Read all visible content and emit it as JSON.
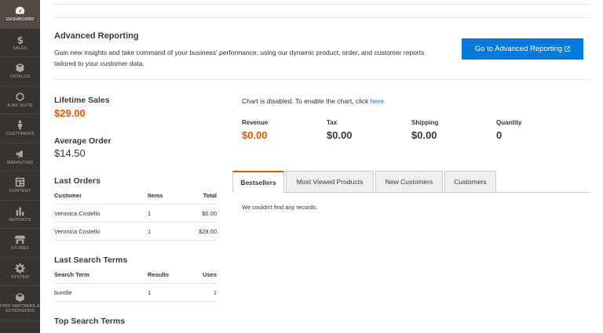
{
  "sidebar": {
    "items": [
      {
        "label": "Dashboard",
        "icon": "dashboard-icon"
      },
      {
        "label": "Sales",
        "icon": "dollar-icon"
      },
      {
        "label": "Catalog",
        "icon": "box-icon"
      },
      {
        "label": "Ajax Suite",
        "icon": "hexagon-icon"
      },
      {
        "label": "Customers",
        "icon": "person-icon"
      },
      {
        "label": "Marketing",
        "icon": "megaphone-icon"
      },
      {
        "label": "Content",
        "icon": "layout-icon"
      },
      {
        "label": "Reports",
        "icon": "bar-chart-icon"
      },
      {
        "label": "Stores",
        "icon": "store-icon"
      },
      {
        "label": "System",
        "icon": "gear-icon"
      },
      {
        "label": "Find Partners & Extensions",
        "icon": "cube-icon"
      }
    ]
  },
  "advanced": {
    "title": "Advanced Reporting",
    "text": "Gain new insights and take command of your business' performance, using our dynamic product, order, and customer reports tailored to your customer data.",
    "button": "Go to Advanced Reporting"
  },
  "lifetime": {
    "label": "Lifetime Sales",
    "value": "$29.00"
  },
  "average": {
    "label": "Average Order",
    "value": "$14.50"
  },
  "last_orders": {
    "title": "Last Orders",
    "headers": [
      "Customer",
      "Items",
      "Total"
    ],
    "rows": [
      [
        "Veronica Costello",
        "1",
        "$0.00"
      ],
      [
        "Veronica Costello",
        "1",
        "$29.00"
      ]
    ]
  },
  "last_search": {
    "title": "Last Search Terms",
    "headers": [
      "Search Term",
      "Results",
      "Uses"
    ],
    "rows": [
      [
        "bundle",
        "1",
        "1"
      ]
    ]
  },
  "top_search": {
    "title": "Top Search Terms"
  },
  "chart": {
    "message": "Chart is disabled. To enable the chart, click ",
    "link": "here."
  },
  "totals": [
    {
      "label": "Revenue",
      "value": "$0.00",
      "color": "#eb5202"
    },
    {
      "label": "Tax",
      "value": "$0.00"
    },
    {
      "label": "Shipping",
      "value": "$0.00"
    },
    {
      "label": "Quantity",
      "value": "0"
    }
  ],
  "tabs": [
    "Bestsellers",
    "Most Viewed Products",
    "New Customers",
    "Customers"
  ],
  "no_records": "We couldn't find any records.",
  "colors": {
    "accent": "#eb5202",
    "link": "#007bdb",
    "sidebar": "#373330"
  }
}
